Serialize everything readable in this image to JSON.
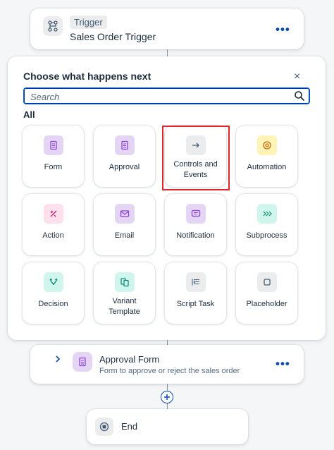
{
  "trigger": {
    "tag": "Trigger",
    "title": "Sales Order Trigger",
    "icon": "workflow-trigger-icon",
    "more_label": "•••"
  },
  "popover": {
    "heading": "Choose what happens next",
    "close_label": "×",
    "search": {
      "placeholder": "Search",
      "value": ""
    },
    "section_label": "All",
    "tiles": [
      {
        "label": "Form",
        "icon": "form-icon",
        "bg": "#e5d5f5",
        "fg": "#8c3fd9"
      },
      {
        "label": "Approval",
        "icon": "approval-icon",
        "bg": "#e5d5f5",
        "fg": "#8c3fd9"
      },
      {
        "label": "Controls and Events",
        "icon": "arrow-right-icon",
        "bg": "#eaecee",
        "fg": "#475e75"
      },
      {
        "label": "Automation",
        "icon": "automation-icon",
        "bg": "#fff3b8",
        "fg": "#c86a00"
      },
      {
        "label": "Action",
        "icon": "action-icon",
        "bg": "#fde0ec",
        "fg": "#cc1a6b"
      },
      {
        "label": "Email",
        "icon": "email-icon",
        "bg": "#e5d5f5",
        "fg": "#8c3fd9"
      },
      {
        "label": "Notification",
        "icon": "notification-icon",
        "bg": "#e5d5f5",
        "fg": "#8c3fd9"
      },
      {
        "label": "Subprocess",
        "icon": "subprocess-icon",
        "bg": "#cff5ec",
        "fg": "#0f8a75"
      },
      {
        "label": "Decision",
        "icon": "decision-icon",
        "bg": "#cff5ec",
        "fg": "#0f8a75"
      },
      {
        "label": "Variant Template",
        "icon": "variant-template-icon",
        "bg": "#cff5ec",
        "fg": "#0f8a75"
      },
      {
        "label": "Script Task",
        "icon": "script-task-icon",
        "bg": "#eaecee",
        "fg": "#475e75"
      },
      {
        "label": "Placeholder",
        "icon": "placeholder-icon",
        "bg": "#eaecee",
        "fg": "#475e75"
      }
    ]
  },
  "approval_step": {
    "title": "Approval Form",
    "subtitle": "Form to approve or reject the sales order",
    "icon": "form-icon",
    "more_label": "•••"
  },
  "end_step": {
    "title": "End",
    "icon": "stop-icon"
  },
  "colors": {
    "accent": "#0a4ba7",
    "highlight": "#e0262a"
  }
}
